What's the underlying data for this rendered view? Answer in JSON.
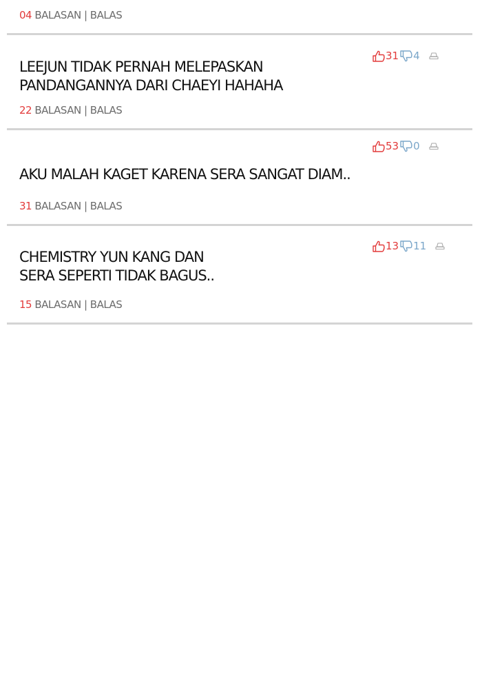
{
  "comments": [
    {
      "replies_count": "04",
      "replies_label": "BALASAN",
      "divider": "|",
      "reply_label": "BALAS"
    },
    {
      "lines": [
        "LEEJUN TIDAK PERNAH MELEPASKAN",
        "PANDANGANNYA DARI CHAEYI HAHAHA"
      ],
      "likes": "31",
      "dislikes": "4",
      "replies_count": "22",
      "replies_label": "BALASAN",
      "divider": "|",
      "reply_label": "BALAS"
    },
    {
      "lines": [
        "AKU MALAH KAGET KARENA SERA SANGAT DIAM.."
      ],
      "likes": "53",
      "dislikes": "0",
      "replies_count": "31",
      "replies_label": "BALASAN",
      "divider": "|",
      "reply_label": "BALAS"
    },
    {
      "lines": [
        "CHEMISTRY YUN KANG DAN",
        "SERA SEPERTI TIDAK BAGUS.."
      ],
      "likes": "13",
      "dislikes": "11",
      "replies_count": "15",
      "replies_label": "BALASAN",
      "divider": "|",
      "reply_label": "BALAS"
    }
  ],
  "icons": {
    "like": "thumbs-up-icon",
    "dislike": "thumbs-down-icon",
    "report": "report-icon"
  },
  "colors": {
    "like": "#e23a3a",
    "dislike": "#7aa6c9",
    "count_accent": "#e23a3a",
    "meta_text": "#6b6b6b",
    "separator": "#d4d4d4"
  }
}
